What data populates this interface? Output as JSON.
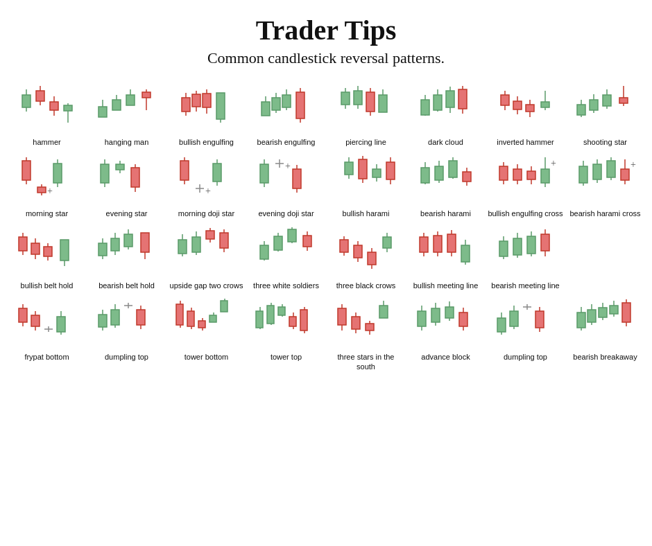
{
  "title": "Trader Tips",
  "subtitle": "Common candlestick reversal patterns.",
  "patterns": [
    [
      {
        "name": "hammer",
        "type": "hammer"
      },
      {
        "name": "hanging man",
        "type": "hanging_man"
      },
      {
        "name": "bullish engulfing",
        "type": "bullish_engulfing"
      },
      {
        "name": "bearish engulfing",
        "type": "bearish_engulfing"
      },
      {
        "name": "piercing line",
        "type": "piercing_line"
      },
      {
        "name": "dark cloud",
        "type": "dark_cloud"
      },
      {
        "name": "inverted hammer",
        "type": "inverted_hammer"
      },
      {
        "name": "shooting star",
        "type": "shooting_star"
      }
    ],
    [
      {
        "name": "morning star",
        "type": "morning_star"
      },
      {
        "name": "evening star",
        "type": "evening_star"
      },
      {
        "name": "morning doji star",
        "type": "morning_doji_star"
      },
      {
        "name": "evening doji star",
        "type": "evening_doji_star"
      },
      {
        "name": "bullish harami",
        "type": "bullish_harami"
      },
      {
        "name": "bearish harami",
        "type": "bearish_harami"
      },
      {
        "name": "bullish engulfing cross",
        "type": "bullish_engulfing_cross"
      },
      {
        "name": "bearish harami cross",
        "type": "bearish_harami_cross"
      }
    ],
    [
      {
        "name": "bullish belt hold",
        "type": "bullish_belt_hold"
      },
      {
        "name": "bearish belt hold",
        "type": "bearish_belt_hold"
      },
      {
        "name": "upside gap two crows",
        "type": "upside_gap_two_crows"
      },
      {
        "name": "three white soldiers",
        "type": "three_white_soldiers"
      },
      {
        "name": "three black crows",
        "type": "three_black_crows"
      },
      {
        "name": "bullish meeting line",
        "type": "bullish_meeting_line"
      },
      {
        "name": "bearish meeting line",
        "type": "bearish_meeting_line"
      },
      {
        "name": "",
        "type": "empty"
      }
    ],
    [
      {
        "name": "frypat bottom",
        "type": "frypat_bottom"
      },
      {
        "name": "dumpling top",
        "type": "dumpling_top"
      },
      {
        "name": "tower bottom",
        "type": "tower_bottom"
      },
      {
        "name": "tower top",
        "type": "tower_top"
      },
      {
        "name": "three stars in the south",
        "type": "three_stars_south"
      },
      {
        "name": "advance block",
        "type": "advance_block"
      },
      {
        "name": "dumpling top",
        "type": "dumpling_top2"
      },
      {
        "name": "bearish breakaway",
        "type": "bearish_breakaway"
      }
    ]
  ]
}
